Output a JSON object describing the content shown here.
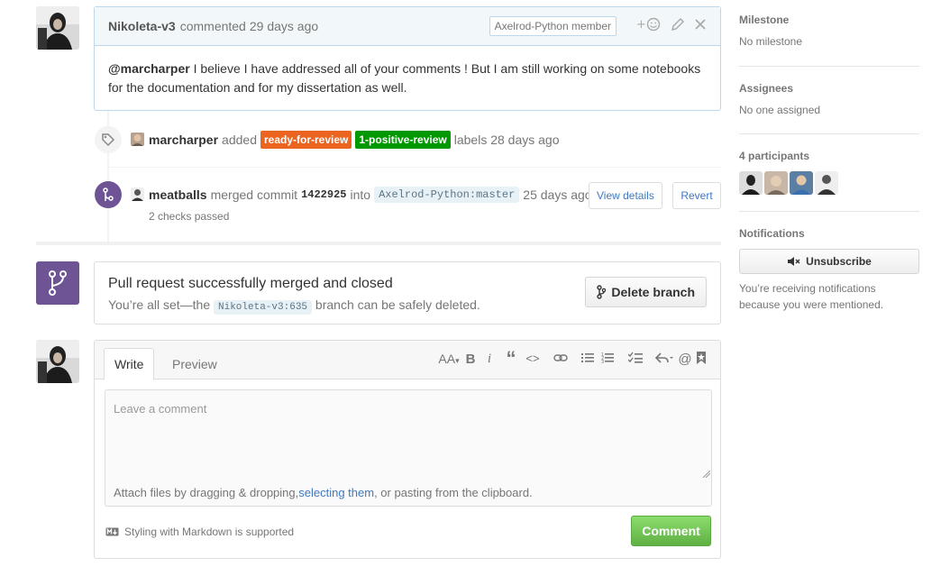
{
  "comment": {
    "author": "Nikoleta-v3",
    "action": "commented",
    "time": "29 days ago",
    "badge": "Axelrod-Python member",
    "mention": "@marcharper",
    "body_line1": " I believe I have addressed all of your comments ! But I am still working on some notebooks",
    "body_line2": "for the documentation and for my dissertation as well."
  },
  "label_event": {
    "actor": "marcharper",
    "verb": "added",
    "labels": [
      {
        "name": "ready-for-review",
        "color": "#eb6420"
      },
      {
        "name": "1-positive-review",
        "color": "#009800"
      }
    ],
    "suffix": "labels 28 days ago"
  },
  "merge_event": {
    "actor": "meatballs",
    "verb": "merged commit",
    "sha": "1422925",
    "into": "into",
    "target": "Axelrod-Python:master",
    "time": "25 days ago",
    "checks": "2 checks passed",
    "view_details": "View details",
    "revert": "Revert"
  },
  "merged_box": {
    "title": "Pull request successfully merged and closed",
    "sub_prefix": "You’re all set—the",
    "branch": "Nikoleta-v3:635",
    "sub_suffix": "branch can be safely deleted.",
    "delete_button": "Delete branch"
  },
  "editor": {
    "tab_write": "Write",
    "tab_preview": "Preview",
    "placeholder": "Leave a comment",
    "attach_prefix": "Attach files by dragging & dropping, ",
    "attach_link": "selecting them",
    "attach_suffix": ", or pasting from the clipboard.",
    "markdown_note": "Styling with Markdown is supported",
    "comment_button": "Comment",
    "toolbar_labels": {
      "heading": "AA",
      "bold": "B",
      "italic": "i",
      "quote": "“",
      "code": "<>",
      "mention": "@"
    }
  },
  "sidebar": {
    "milestone_title": "Milestone",
    "milestone_value": "No milestone",
    "assignees_title": "Assignees",
    "assignees_value": "No one assigned",
    "participants_title": "4 participants",
    "notifications_title": "Notifications",
    "unsubscribe": "Unsubscribe",
    "notif_reason": "You’re receiving notifications because you were mentioned."
  },
  "colors": {
    "merged_purple": "#6e5494",
    "link_blue": "#4078c0",
    "comment_green": "#60b044"
  }
}
